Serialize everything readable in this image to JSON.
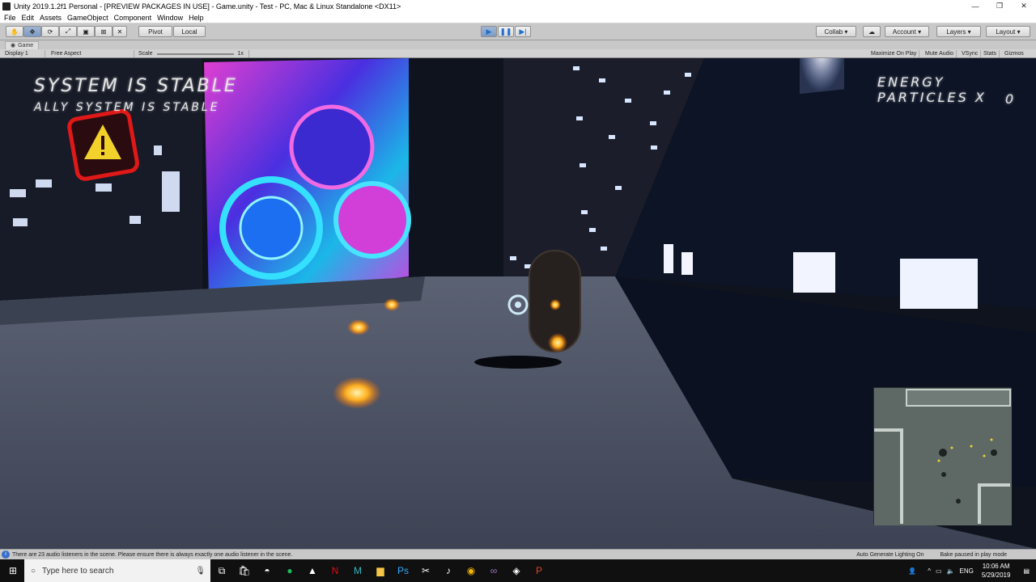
{
  "window": {
    "title": "Unity 2019.1.2f1 Personal - [PREVIEW PACKAGES IN USE] - Game.unity - Test - PC, Mac & Linux Standalone <DX11>",
    "minimize": "—",
    "maximize": "❐",
    "close": "✕"
  },
  "menu": [
    "File",
    "Edit",
    "Assets",
    "GameObject",
    "Component",
    "Window",
    "Help"
  ],
  "toolbar": {
    "pivot": "Pivot",
    "local": "Local",
    "collab": "Collab ▾",
    "account": "Account",
    "layers": "Layers",
    "layout": "Layout"
  },
  "game_tab": {
    "label": "Game"
  },
  "game_options": {
    "display": "Display 1",
    "aspect": "Free Aspect",
    "scale_label": "Scale",
    "scale_value": "1x",
    "maximize_on_play": "Maximize On Play",
    "mute_audio": "Mute Audio",
    "vsync": "VSync",
    "stats": "Stats",
    "gizmos": "Gizmos"
  },
  "hud": {
    "line1": "SYSTEM IS STABLE",
    "line2": "ALLY SYSTEM IS STABLE",
    "energy_label": "ENERGY PARTICLES X",
    "energy_value": "0"
  },
  "status": {
    "message": "There are 23 audio listeners in the scene. Please ensure there is always exactly one audio listener in the scene.",
    "lighting": "Auto Generate Lighting On",
    "bake": "Bake paused in play mode"
  },
  "taskbar": {
    "search_placeholder": "Type here to search",
    "lang": "ENG",
    "time": "10:06 AM",
    "date": "5/29/2019"
  },
  "colors": {
    "accent": "#1f6fd0",
    "orb": "#ffb020",
    "screen_magenta": "#e23fd0",
    "warning_red": "#e01818"
  }
}
